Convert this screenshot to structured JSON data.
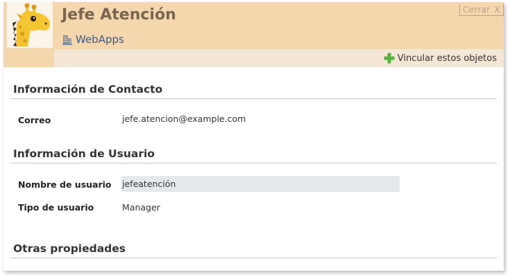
{
  "header": {
    "title": "Jefe Atención",
    "organization": "WebApps",
    "close_label": "Cerrar",
    "close_x": "X",
    "link_objects_label": "Vincular estos objetos"
  },
  "sections": {
    "contact": {
      "title": "Información de Contacto",
      "email_label": "Correo",
      "email_value": "jefe.atencion@example.com"
    },
    "user": {
      "title": "Información de Usuario",
      "username_label": "Nombre de usuario",
      "username_value": "jefeatención",
      "type_label": "Tipo de usuario",
      "type_value": "Manager"
    },
    "other": {
      "title": "Otras propiedades"
    }
  },
  "icons": {
    "avatar": "giraffe-icon",
    "organization": "building-icon",
    "add": "plus-icon"
  },
  "colors": {
    "header_bg": "#f5d7ae",
    "toolbar_bg": "#f5e7d5",
    "title": "#7a6650",
    "link": "#3a5a85",
    "plus": "#55b23f",
    "field_bg": "#e3e9ec"
  }
}
